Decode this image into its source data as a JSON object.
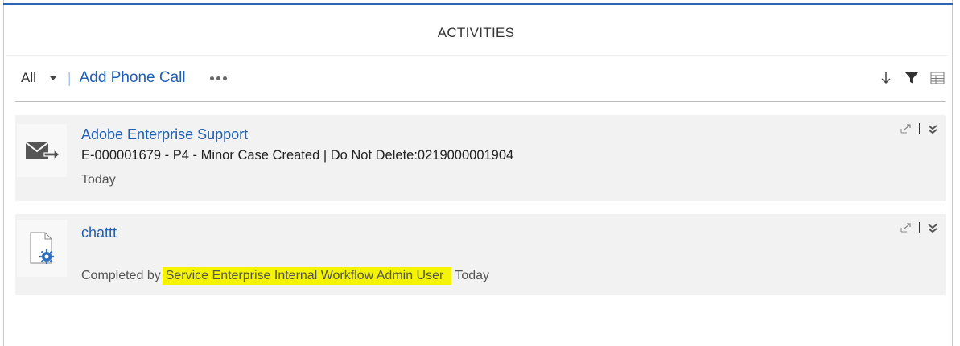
{
  "panel": {
    "title": "ACTIVITIES",
    "accent_color": "#2b63b6"
  },
  "toolbar": {
    "filter_value": "All",
    "add_phone_call_label": "Add Phone Call",
    "more_icon": "more-dots-icon",
    "right_icons": [
      "sort-down-icon",
      "filter-icon",
      "grid-view-icon"
    ]
  },
  "activities": [
    {
      "icon": "email-forward-icon",
      "title": "Adobe Enterprise Support",
      "subject": "E-000001679  - P4 - Minor  Case Created | Do Not Delete:0219000001904",
      "date": "Today"
    },
    {
      "icon": "task-gear-document-icon",
      "title": "chattt",
      "completed_by_prefix": "Completed by",
      "completed_by_user": "Service Enterprise Internal Workflow Admin User",
      "date": "Today",
      "highlight_color": "#f4f400"
    }
  ],
  "link_color": "#1f5fb4"
}
